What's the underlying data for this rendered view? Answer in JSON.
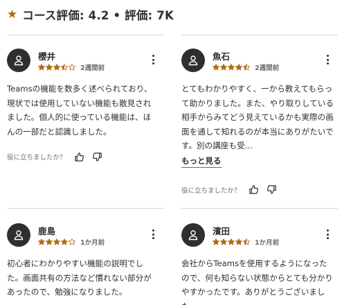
{
  "header": {
    "star_icon": "star-icon",
    "title": "コース評価: 4.2 • 評価: 7K"
  },
  "reviews": [
    {
      "name": "櫻井",
      "rating": 3.5,
      "date": "2週間前",
      "text": "Teamsの機能を数多く述べられており、現状では使用していない機能も散見されました。個人的に使っている機能は、ほんの一部だと認識しました。",
      "helpful_question": "役に立ちましたか？",
      "show_more": ""
    },
    {
      "name": "魚石",
      "rating": 4.5,
      "date": "2週間前",
      "text": "とてもわかりやすく、一から教えてもらって助かりました。また、やり取りしている相手からみてどう見えているかも実際の画面を通して知れるのが本当にありがたいです。別の講座も受…",
      "helpful_question": "役に立ちましたか？",
      "show_more": "もっと見る"
    },
    {
      "name": "鹿島",
      "rating": 4,
      "date": "1か月前",
      "text": "初心者にわかりやすい機能の説明でした。画面共有の方法など慣れない部分があったので、勉強になりました。",
      "helpful_question": "",
      "show_more": ""
    },
    {
      "name": "濱田",
      "rating": 4.5,
      "date": "1か月前",
      "text": "会社からTeamsを使用するようになったので、何も知らない状態からとても分かりやすかったです。ありがとうございました。",
      "helpful_question": "",
      "show_more": ""
    }
  ],
  "colors": {
    "star": "#b4690e",
    "text": "#2d2f31",
    "muted": "#6a6f73",
    "accent_underline": "#a435f0",
    "divider": "#d1d7dc"
  }
}
